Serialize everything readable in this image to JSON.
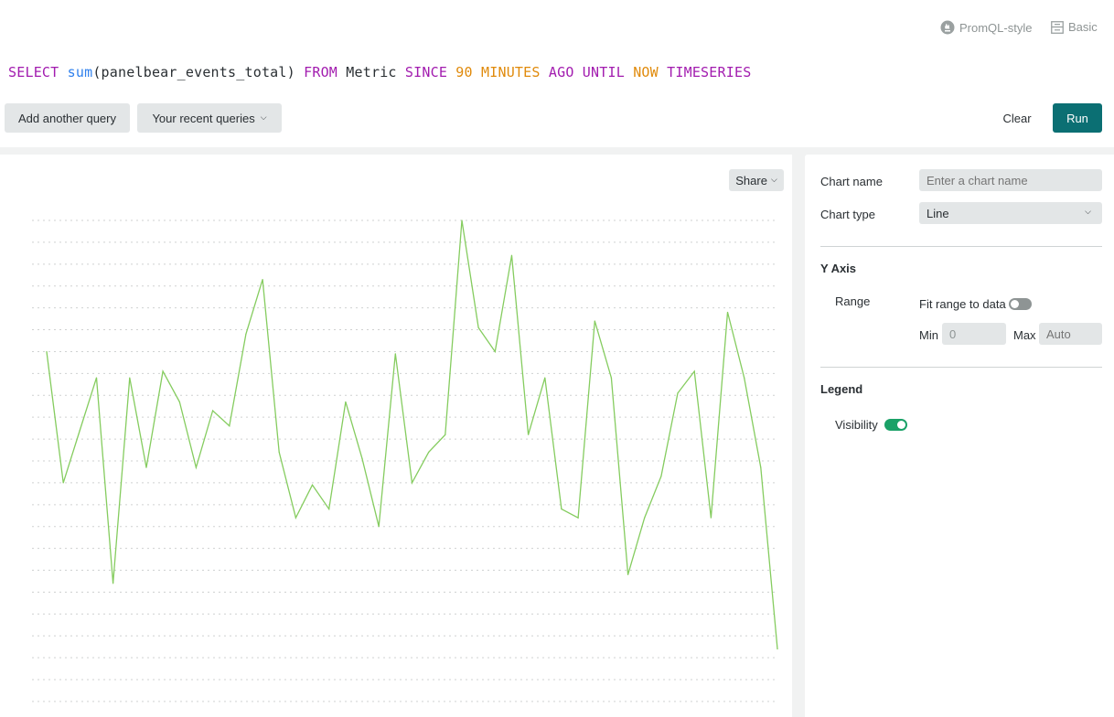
{
  "mode_toggles": {
    "promql": {
      "label": "PromQL-style",
      "icon": "prometheus-icon"
    },
    "basic": {
      "label": "Basic",
      "icon": "form-icon"
    }
  },
  "query": {
    "tokens": [
      {
        "text": "SELECT",
        "kind": "keyword"
      },
      {
        "text": " ",
        "kind": "text"
      },
      {
        "text": "sum",
        "kind": "function"
      },
      {
        "text": "(panelbear_events_total)",
        "kind": "text"
      },
      {
        "text": " ",
        "kind": "text"
      },
      {
        "text": "FROM",
        "kind": "keyword"
      },
      {
        "text": " Metric ",
        "kind": "text"
      },
      {
        "text": "SINCE",
        "kind": "keyword"
      },
      {
        "text": " ",
        "kind": "text"
      },
      {
        "text": "90",
        "kind": "number"
      },
      {
        "text": " ",
        "kind": "text"
      },
      {
        "text": "MINUTES",
        "kind": "number"
      },
      {
        "text": " ",
        "kind": "text"
      },
      {
        "text": "AGO",
        "kind": "keyword"
      },
      {
        "text": " ",
        "kind": "text"
      },
      {
        "text": "UNTIL",
        "kind": "keyword"
      },
      {
        "text": " ",
        "kind": "text"
      },
      {
        "text": "NOW",
        "kind": "number"
      },
      {
        "text": " ",
        "kind": "text"
      },
      {
        "text": "TIMESERIES",
        "kind": "keyword"
      }
    ],
    "colors": {
      "keyword": "#a21caf",
      "function": "#2f80ed",
      "number": "#e08a0b",
      "text": "#2a2f33"
    }
  },
  "toolbar": {
    "add_query_label": "Add another query",
    "recent_queries_label": "Your recent queries",
    "clear_label": "Clear",
    "run_label": "Run",
    "run_color": "#0b6f73"
  },
  "chart_panel": {
    "share_label": "Share"
  },
  "settings": {
    "chart_name_label": "Chart name",
    "chart_name_placeholder": "Enter a chart name",
    "chart_name_value": "",
    "chart_type_label": "Chart type",
    "chart_type_value": "Line",
    "y_axis_title": "Y Axis",
    "range_label": "Range",
    "fit_range_label": "Fit range to data",
    "fit_range_on": false,
    "min_label": "Min",
    "min_value": "0",
    "max_label": "Max",
    "max_placeholder": "Auto",
    "legend_title": "Legend",
    "visibility_label": "Visibility",
    "visibility_on": true,
    "toggle_on_color": "#1aa167",
    "toggle_off_color": "#8e9494"
  },
  "chart_data": {
    "type": "line",
    "title": "",
    "xlabel": "",
    "ylabel": "",
    "grid": true,
    "grid_lines": 23,
    "ylim": [
      0,
      22
    ],
    "y_units": "relative (gridline units, no tick labels shown)",
    "series": [
      {
        "name": "sum(panelbear_events_total)",
        "color": "#85cc5f",
        "values": [
          16.0,
          10.0,
          12.4,
          14.8,
          5.4,
          14.8,
          10.7,
          15.1,
          13.7,
          10.7,
          13.3,
          12.6,
          16.8,
          19.3,
          11.4,
          8.4,
          9.9,
          8.8,
          13.7,
          11.1,
          8.0,
          15.9,
          10.0,
          11.4,
          12.2,
          22.0,
          17.1,
          16.0,
          20.4,
          12.2,
          14.8,
          8.8,
          8.4,
          17.4,
          14.8,
          5.8,
          8.4,
          10.3,
          14.1,
          15.1,
          8.4,
          17.8,
          14.8,
          10.7,
          2.4
        ]
      }
    ]
  }
}
